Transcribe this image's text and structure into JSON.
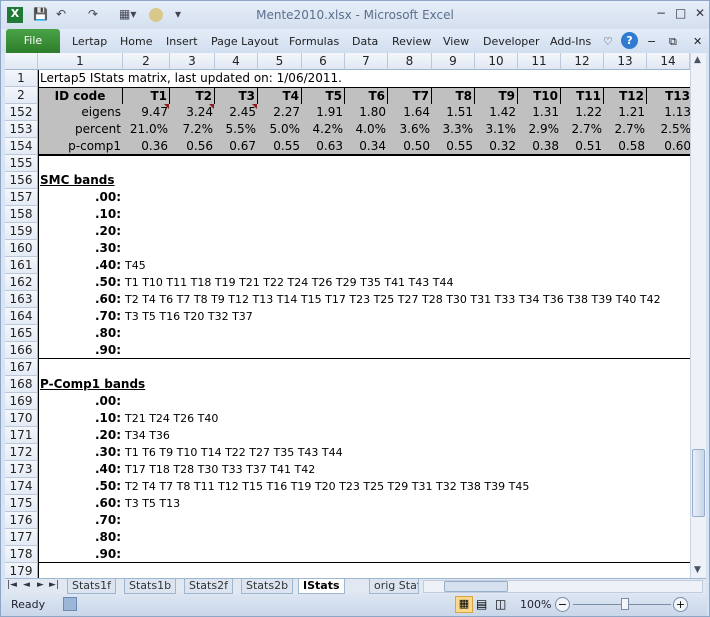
{
  "window": {
    "title": "Mente2010.xlsx - Microsoft Excel",
    "minimize": "−",
    "restore": "□",
    "close": "✕"
  },
  "quick_access": {
    "save": "💾",
    "undo": "↶",
    "redo": "↷",
    "customize": "▾"
  },
  "ribbon": {
    "file": "File",
    "tabs": [
      "Lertap",
      "Home",
      "Insert",
      "Page Layout",
      "Formulas",
      "Data",
      "Review",
      "View",
      "Developer",
      "Add-Ins"
    ],
    "help": "?"
  },
  "columns": [
    "1",
    "2",
    "3",
    "4",
    "5",
    "6",
    "7",
    "8",
    "9",
    "10",
    "11",
    "12",
    "13",
    "14"
  ],
  "row1": {
    "num": "1",
    "text": "Lertap5 IStats matrix, last updated on: 1/06/2011."
  },
  "header_row": {
    "num": "2",
    "cells": [
      "ID code",
      "T1",
      "T2",
      "T3",
      "T4",
      "T5",
      "T6",
      "T7",
      "T8",
      "T9",
      "T10",
      "T11",
      "T12",
      "T13"
    ]
  },
  "stats_rows": [
    {
      "num": "152",
      "cells": [
        "eigens",
        "9.47",
        "3.24",
        "2.45",
        "2.27",
        "1.91",
        "1.80",
        "1.64",
        "1.51",
        "1.42",
        "1.31",
        "1.22",
        "1.21",
        "1.13"
      ]
    },
    {
      "num": "153",
      "cells": [
        "percent",
        "21.0%",
        "7.2%",
        "5.5%",
        "5.0%",
        "4.2%",
        "4.0%",
        "3.6%",
        "3.3%",
        "3.1%",
        "2.9%",
        "2.7%",
        "2.7%",
        "2.5%"
      ]
    },
    {
      "num": "154",
      "cells": [
        "p-comp1",
        "0.36",
        "0.56",
        "0.67",
        "0.55",
        "0.63",
        "0.34",
        "0.50",
        "0.55",
        "0.32",
        "0.38",
        "0.51",
        "0.58",
        "0.60"
      ]
    }
  ],
  "blank_rows": [
    "155",
    "167",
    "179"
  ],
  "smc": {
    "title_row": "156",
    "title": "SMC bands",
    "bands": [
      {
        "num": "157",
        "label": ".00:",
        "items": ""
      },
      {
        "num": "158",
        "label": ".10:",
        "items": ""
      },
      {
        "num": "159",
        "label": ".20:",
        "items": ""
      },
      {
        "num": "160",
        "label": ".30:",
        "items": ""
      },
      {
        "num": "161",
        "label": ".40:",
        "items": "T45"
      },
      {
        "num": "162",
        "label": ".50:",
        "items": "T1 T10 T11 T18 T19 T21 T22 T24 T26 T29 T35 T41 T43 T44"
      },
      {
        "num": "163",
        "label": ".60:",
        "items": "T2 T4 T6 T7 T8 T9 T12 T13 T14 T15 T17 T23 T25 T27 T28 T30 T31 T33 T34 T36 T38 T39 T40 T42"
      },
      {
        "num": "164",
        "label": ".70:",
        "items": "T3 T5 T16 T20 T32 T37"
      },
      {
        "num": "165",
        "label": ".80:",
        "items": ""
      },
      {
        "num": "166",
        "label": ".90:",
        "items": ""
      }
    ]
  },
  "pcomp": {
    "title_row": "168",
    "title": "P-Comp1 bands",
    "bands": [
      {
        "num": "169",
        "label": ".00:",
        "items": ""
      },
      {
        "num": "170",
        "label": ".10:",
        "items": "T21 T24 T26 T40"
      },
      {
        "num": "171",
        "label": ".20:",
        "items": "T34 T36"
      },
      {
        "num": "172",
        "label": ".30:",
        "items": "T1 T6 T9 T10 T14 T22 T27 T35 T43 T44"
      },
      {
        "num": "173",
        "label": ".40:",
        "items": "T17 T18 T28 T30 T33 T37 T41 T42"
      },
      {
        "num": "174",
        "label": ".50:",
        "items": "T2 T4 T7 T8 T11 T12 T15 T16 T19 T20 T23 T25 T29 T31 T32 T38 T39 T45"
      },
      {
        "num": "175",
        "label": ".60:",
        "items": "T3 T5 T13"
      },
      {
        "num": "176",
        "label": ".70:",
        "items": ""
      },
      {
        "num": "177",
        "label": ".80:",
        "items": ""
      },
      {
        "num": "178",
        "label": ".90:",
        "items": ""
      }
    ]
  },
  "sheet_tabs": {
    "tabs": [
      "Stats1f",
      "Stats1b",
      "Stats2f",
      "Stats2b",
      "IStats",
      "orig Stats"
    ],
    "active": "IStats",
    "nav": [
      "|◄",
      "◄",
      "►",
      "►|"
    ]
  },
  "statusbar": {
    "ready": "Ready",
    "zoom": "100%",
    "zoom_level": 100,
    "minus": "−",
    "plus": "+"
  }
}
